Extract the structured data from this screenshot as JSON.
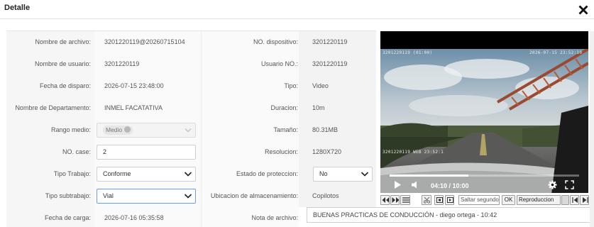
{
  "dialog": {
    "title": "Detalle"
  },
  "fields": {
    "nombre_archivo": {
      "label": "Nombre de archivo:",
      "value": "3201220119@20260715104"
    },
    "no_dispositivo": {
      "label": "NO. dispositivo:",
      "value": "3201220119"
    },
    "nombre_usuario": {
      "label": "Nombre de usuario:",
      "value": "3201220119"
    },
    "usuario_no": {
      "label": "Usuario NO.:",
      "value": "3201220119"
    },
    "fecha_disparo": {
      "label": "Fecha de disparo:",
      "value": "2026-07-15 23:48:00"
    },
    "tipo": {
      "label": "Tipo:",
      "value": "Video"
    },
    "departamento": {
      "label": "Nombre de Departamento:",
      "value": "INMEL FACATATIVA"
    },
    "duracion": {
      "label": "Duracion:",
      "value": "10m"
    },
    "rango_medio": {
      "label": "Rango medio:",
      "value": "Medio"
    },
    "tamano": {
      "label": "Tamaño:",
      "value": "80.31MB"
    },
    "no_case": {
      "label": "NO. case:",
      "value": "2"
    },
    "resolucion": {
      "label": "Resolucion:",
      "value": "1280X720"
    },
    "tipo_trabajo": {
      "label": "Tipo Trabajo:",
      "value": "Conforme"
    },
    "estado_proteccion": {
      "label": "Estado de proteccion:",
      "value": "No"
    },
    "tipo_subtrabajo": {
      "label": "Tipo subtrabajo:",
      "value": "Vial"
    },
    "ubicacion": {
      "label": "Ubicacion de almacenamiento:",
      "value": "Copilotos"
    },
    "fecha_carga": {
      "label": "Fecha de carga:",
      "value": "2026-07-16 05:35:58"
    },
    "nota_archivo": {
      "label": "Nota de archivo:",
      "value": "BUENAS PRACTICAS DE CONDUCCIÓN - diego ortega - 10:42"
    }
  },
  "player": {
    "time_display": "04:10 / 10:00",
    "progress_fraction": 0.417,
    "osd_top_left": "3201220119 (01:00)",
    "osd_top_right": "2026-07-15 23:52:10",
    "osd_bottom_left": "3201220119 WEB 23:52:1"
  },
  "toolbar": {
    "seek_placeholder": "Saltar segundos",
    "ok_label": "OK",
    "speed_label": "Reproduccion"
  },
  "colors": {
    "close_icon": "#111111",
    "player_bg": "#000000",
    "focus_border": "#6aa0e0"
  }
}
